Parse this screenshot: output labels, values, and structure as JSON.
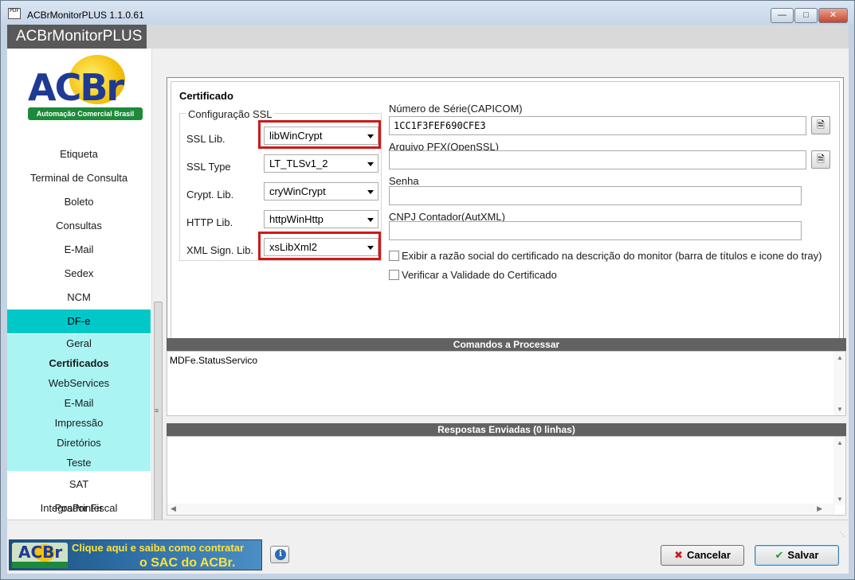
{
  "window": {
    "title": "ACBrMonitorPLUS 1.1.0.61",
    "app_header": "ACBrMonitorPLUS",
    "icon_text": "PDF"
  },
  "logo": {
    "ac": "AC",
    "br": "Br",
    "tagline": "Automação Comercial Brasil"
  },
  "sidebar": {
    "items": [
      {
        "label": "Etiqueta"
      },
      {
        "label": "Terminal de Consulta"
      },
      {
        "label": "Boleto"
      },
      {
        "label": "Consultas"
      },
      {
        "label": "E-Mail"
      },
      {
        "label": "Sedex"
      },
      {
        "label": "NCM"
      },
      {
        "label": "DF-e"
      },
      {
        "label": "Geral"
      },
      {
        "label": "Certificados"
      },
      {
        "label": "WebServices"
      },
      {
        "label": "E-Mail"
      },
      {
        "label": "Impressão"
      },
      {
        "label": "Diretórios"
      },
      {
        "label": "Teste"
      },
      {
        "label": "SAT"
      },
      {
        "label": "Integrador Fiscal"
      },
      {
        "label": "PosPrinter"
      }
    ],
    "active_group": "DF-e",
    "active_item": "Certificados"
  },
  "certificado": {
    "section_title": "Certificado",
    "ssl_group_title": "Configuração SSL",
    "fields": [
      {
        "label": "SSL Lib.",
        "value": "libWinCrypt"
      },
      {
        "label": "SSL Type",
        "value": "LT_TLSv1_2"
      },
      {
        "label": "Crypt. Lib.",
        "value": "cryWinCrypt"
      },
      {
        "label": "HTTP Lib.",
        "value": "httpWinHttp"
      },
      {
        "label": "XML Sign. Lib.",
        "value": "xsLibXml2"
      }
    ],
    "serial_label": "Número de Série(CAPICOM)",
    "serial_value": "1CC1F3FEF690CFE3",
    "pfx_label": "Arquivo PFX(OpenSSL)",
    "pfx_value": "",
    "senha_label": "Senha",
    "senha_value": "",
    "cnpj_label": "CNPJ Contador(AutXML)",
    "cnpj_value": "",
    "check_razao": "Exibir a razão social do certificado na descrição do monitor (barra de títulos e icone do tray)",
    "check_validade": "Verificar a Validade do Certificado"
  },
  "comandos": {
    "header": "Comandos a Processar",
    "text": "MDFe.StatusServico"
  },
  "respostas": {
    "header": "Respostas Enviadas (0 linhas)"
  },
  "bottom": {
    "banner_line1": "Clique aqui e saiba como contratar",
    "banner_line2": "o SAC do ACBr.",
    "cancel_label": "Cancelar",
    "save_label": "Salvar"
  },
  "colors": {
    "sidebar_group": "#00c8c8",
    "sidebar_sub": "#aaf4f4",
    "highlight": "#d01818",
    "panel_header": "#626262"
  }
}
